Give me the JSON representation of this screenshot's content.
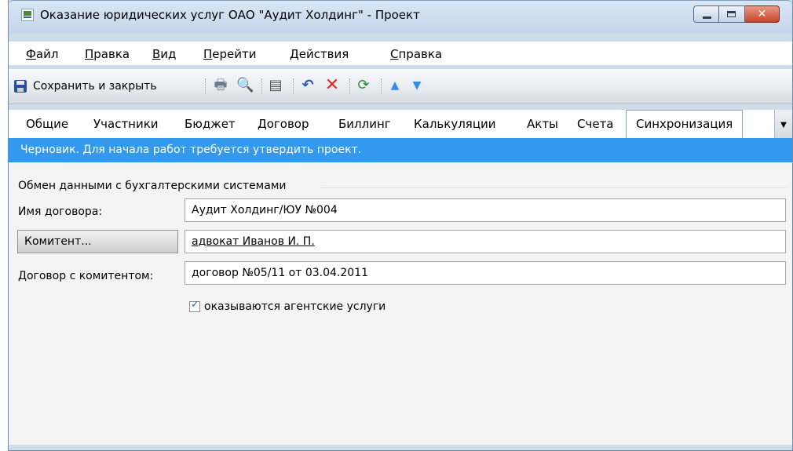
{
  "window": {
    "title": "Оказание юридических услуг ОАО \"Аудит Холдинг\" - Проект",
    "icon": "document-form-icon",
    "controls": {
      "minimize": "minimize-icon",
      "maximize": "maximize-icon",
      "close": "✕"
    }
  },
  "menu": {
    "items": [
      {
        "accel": "Ф",
        "rest": "айл"
      },
      {
        "accel": "П",
        "rest": "равка"
      },
      {
        "accel": "В",
        "rest": "ид"
      },
      {
        "accel": "П",
        "rest": "ерейти"
      },
      {
        "accel": "Д",
        "rest": "ействия"
      },
      {
        "accel": "С",
        "rest": "правка"
      }
    ]
  },
  "toolbar": {
    "save_close_label": "Сохранить и закрыть",
    "icons": [
      "print-icon",
      "print-preview-icon",
      "properties-icon",
      "undo-icon",
      "delete-icon",
      "refresh-icon",
      "previous-icon",
      "next-icon"
    ]
  },
  "tabs": {
    "items": [
      "Общие",
      "Участники",
      "Бюджет",
      "Договор",
      "Биллинг",
      "Калькуляции",
      "Акты",
      "Счета",
      "Синхронизация"
    ],
    "active": "Синхронизация"
  },
  "status": {
    "text": "Черновик. Для начала работ требуется утвердить проект.",
    "color": "#3399ee"
  },
  "form": {
    "group_title": "Обмен данными с бухгалтерскими системами",
    "contract_name_label": "Имя договора:",
    "contract_name_value": "Аудит Холдинг/ЮУ №004",
    "principal_button": "Комитент...",
    "principal_value": "адвокат Иванов И. П.",
    "principal_contract_label": "Договор с комитентом:",
    "principal_contract_value": "договор №05/11 от 03.04.2011",
    "agency_services_label": "оказываются агентские услуги",
    "agency_services_checked": true
  }
}
